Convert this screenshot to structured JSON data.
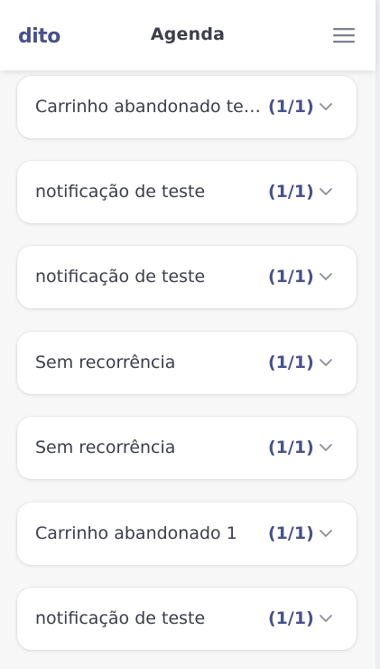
{
  "header": {
    "logo_text": "dito",
    "title": "Agenda",
    "menu_icon": "hamburger-menu-icon"
  },
  "schedules": [
    {
      "title": "Carrinho abandonado teste",
      "count": "(1/1)"
    },
    {
      "title": "notificação de teste",
      "count": "(1/1)"
    },
    {
      "title": "notificação de teste",
      "count": "(1/1)"
    },
    {
      "title": "Sem recorrência",
      "count": "(1/1)"
    },
    {
      "title": "Sem recorrência",
      "count": "(1/1)"
    },
    {
      "title": "Carrinho abandonado 1",
      "count": "(1/1)"
    },
    {
      "title": "notificação de teste",
      "count": "(1/1)"
    }
  ],
  "colors": {
    "brand": "#4a5189",
    "text": "#3a3d48",
    "chevron": "#8a8d99"
  }
}
